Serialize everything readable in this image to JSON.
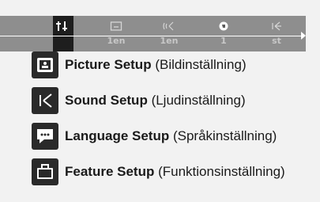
{
  "topbar": {
    "icons": [
      "settings-icon",
      "picture-icon",
      "sound-icon",
      "language-icon",
      "feature-icon"
    ],
    "labels": [
      "1en",
      "1en",
      "1",
      "st"
    ],
    "active": "settings-icon"
  },
  "menu": {
    "items": [
      {
        "icon": "picture-setup-icon",
        "title": "Picture Setup",
        "subtitle": "(Bildinställning)"
      },
      {
        "icon": "sound-setup-icon",
        "title": "Sound Setup",
        "subtitle": "(Ljudinställning)"
      },
      {
        "icon": "language-setup-icon",
        "title": "Language Setup",
        "subtitle": "(Språkinställning)"
      },
      {
        "icon": "feature-setup-icon",
        "title": "Feature Setup",
        "subtitle": "(Funktionsinställning)"
      }
    ]
  },
  "colors": {
    "topbar_bg": "#8e8e8e",
    "active_bg": "#1e1e1e",
    "icon_bg": "#2a2a2a",
    "page_bg": "#f2f2f2"
  }
}
